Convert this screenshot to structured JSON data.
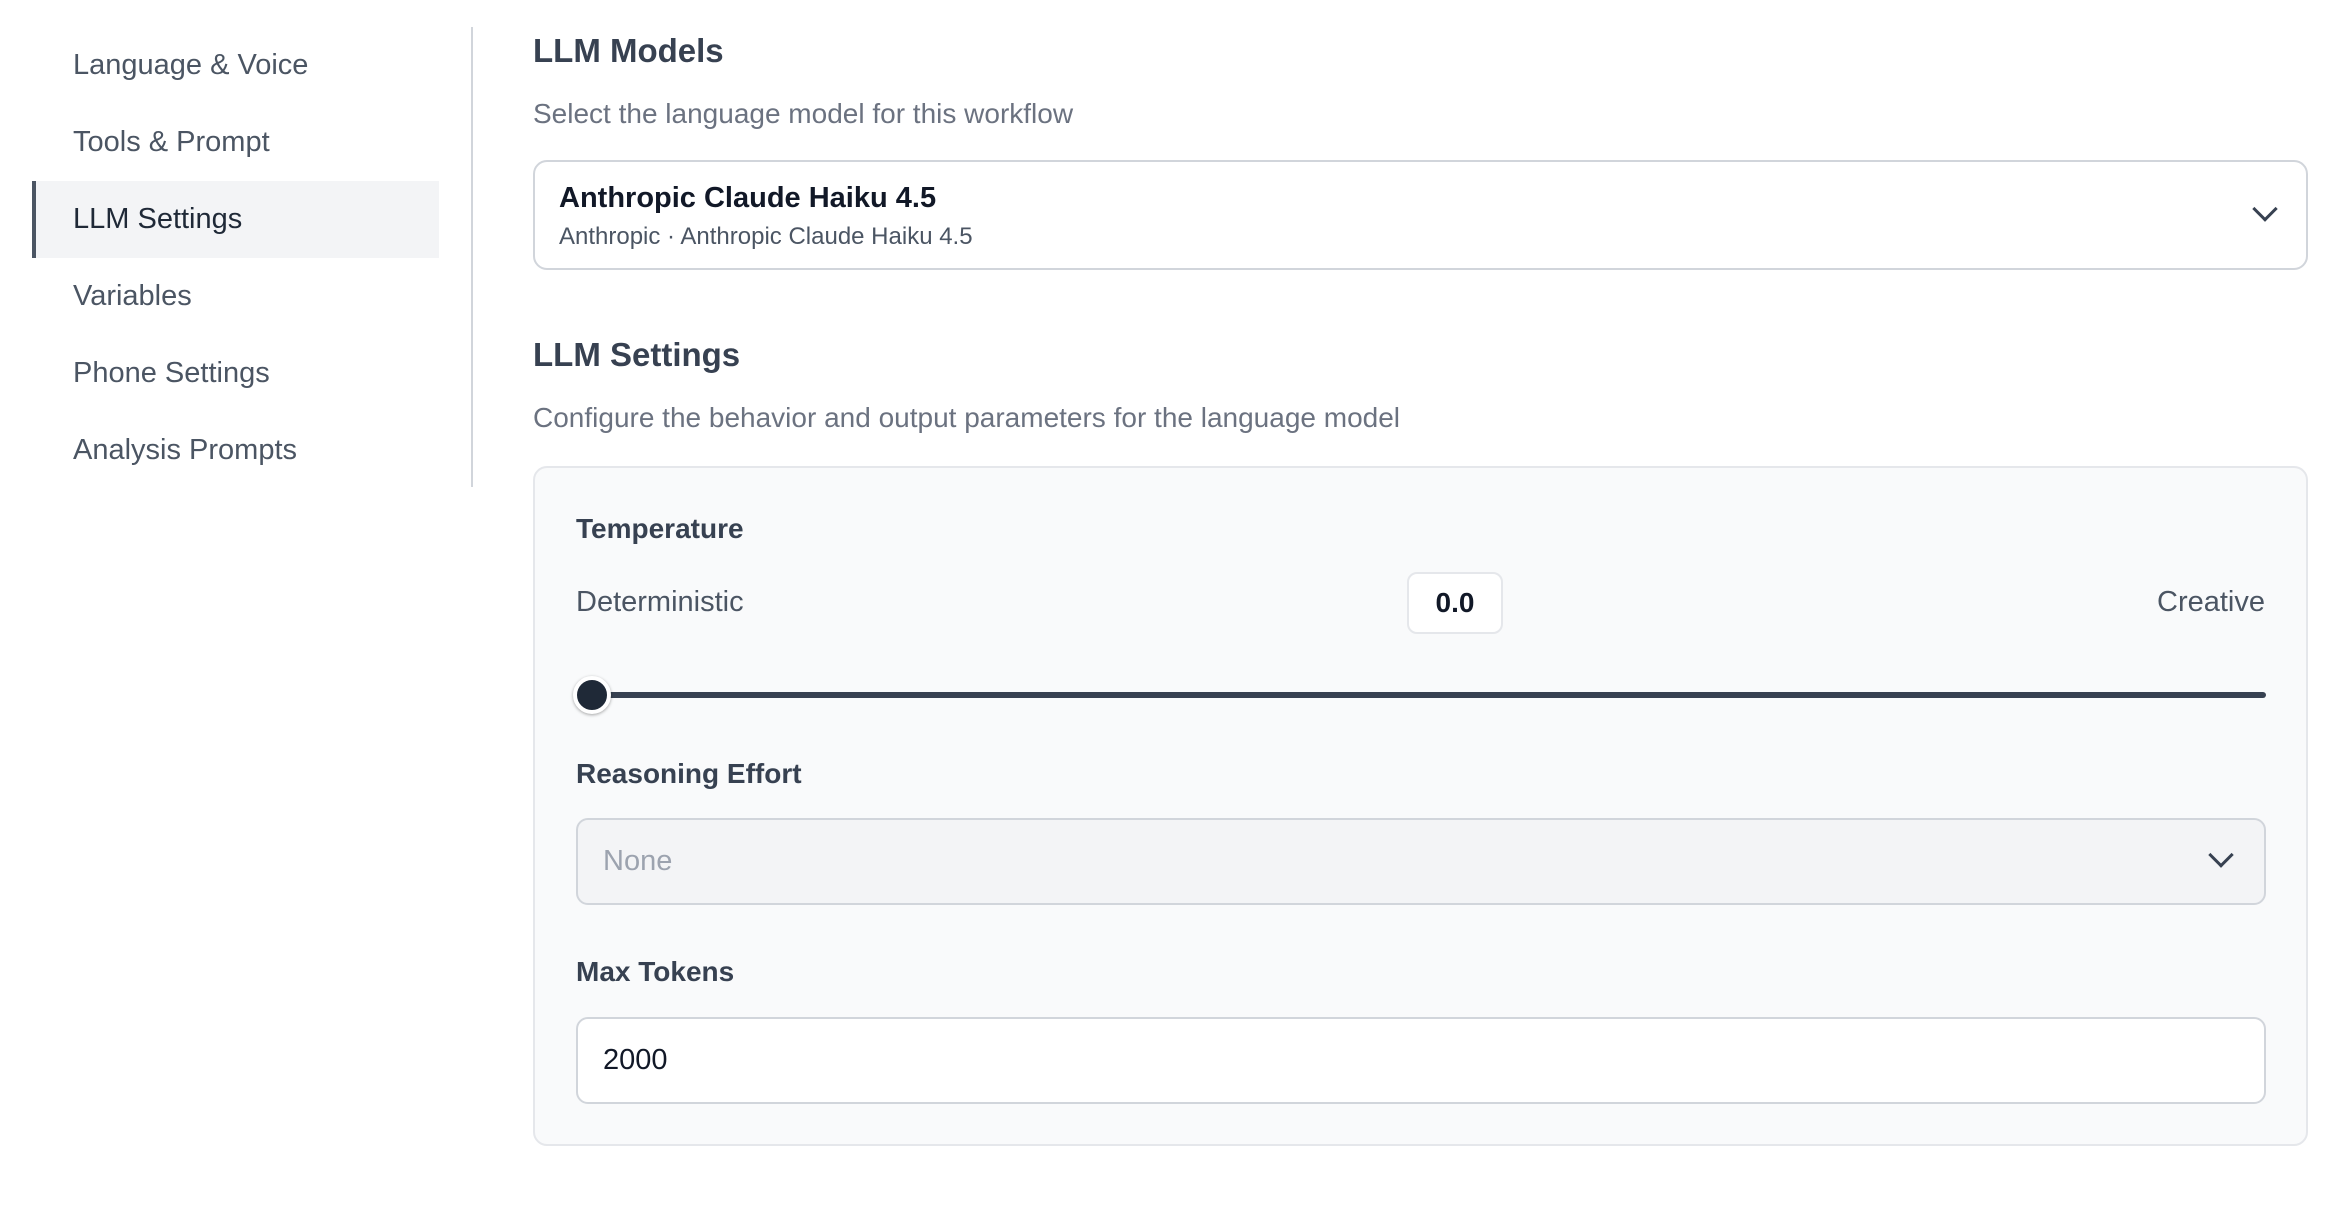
{
  "sidebar": {
    "items": [
      {
        "label": "Language & Voice",
        "active": false
      },
      {
        "label": "Tools & Prompt",
        "active": false
      },
      {
        "label": "LLM Settings",
        "active": true
      },
      {
        "label": "Variables",
        "active": false
      },
      {
        "label": "Phone Settings",
        "active": false
      },
      {
        "label": "Analysis Prompts",
        "active": false
      }
    ]
  },
  "llm_models": {
    "title": "LLM Models",
    "description": "Select the language model for this workflow",
    "selected_model": {
      "name": "Anthropic Claude Haiku 4.5",
      "subtitle": "Anthropic · Anthropic Claude Haiku 4.5"
    }
  },
  "llm_settings": {
    "title": "LLM Settings",
    "description": "Configure the behavior and output parameters for the language model",
    "temperature": {
      "label": "Temperature",
      "min_label": "Deterministic",
      "max_label": "Creative",
      "value": "0.0",
      "fraction": 0.0
    },
    "reasoning_effort": {
      "label": "Reasoning Effort",
      "selected": "None"
    },
    "max_tokens": {
      "label": "Max Tokens",
      "value": "2000"
    }
  },
  "icons": {
    "model_dropdown": "chevron-down-icon",
    "reasoning_dropdown": "chevron-down-icon"
  }
}
